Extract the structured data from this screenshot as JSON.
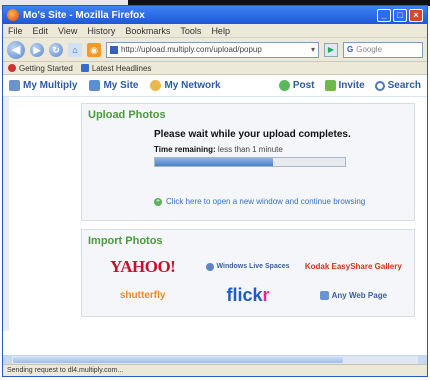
{
  "window": {
    "title": "Mo's Site - Mozilla Firefox"
  },
  "menu": [
    "File",
    "Edit",
    "View",
    "History",
    "Bookmarks",
    "Tools",
    "Help"
  ],
  "address": {
    "url": "http://upload.multiply.com/upload/popup"
  },
  "search": {
    "placeholder": "Google"
  },
  "bookmarks": [
    "Getting Started",
    "Latest Headlines"
  ],
  "site_nav": {
    "left": [
      "My Multiply",
      "My Site",
      "My Network"
    ],
    "right": [
      "Post",
      "Invite",
      "Search"
    ]
  },
  "upload": {
    "title": "Upload Photos",
    "message": "Please wait while your upload completes.",
    "remaining_label": "Time remaining:",
    "remaining_value": "less than 1 minute",
    "progress": 0.62,
    "new_window_link": "Click here to open a new window and continue browsing"
  },
  "import": {
    "title": "Import Photos",
    "sources": [
      "YAHOO!",
      "Windows Live Spaces",
      "Kodak EasyShare Gallery",
      "shutterfly",
      "flickr",
      "Any Web Page"
    ]
  },
  "status": {
    "text": "Sending request to dl4.multiply.com..."
  }
}
